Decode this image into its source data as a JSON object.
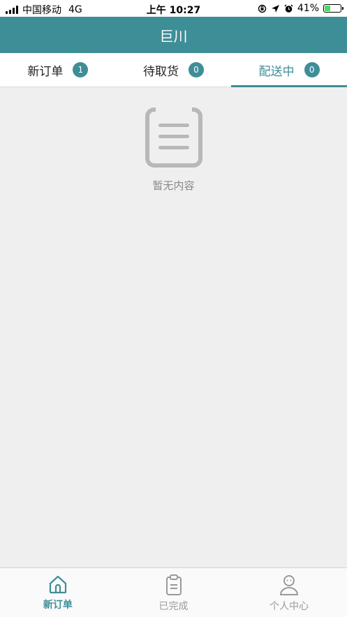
{
  "status_bar": {
    "carrier": "中国移动",
    "network": "4G",
    "time": "上午 10:27",
    "battery": "41%",
    "battery_level": 0.41
  },
  "header": {
    "title": "巨川"
  },
  "tabs": [
    {
      "label": "新订单",
      "count": "1"
    },
    {
      "label": "待取货",
      "count": "0"
    },
    {
      "label": "配送中",
      "count": "0"
    }
  ],
  "empty_state": {
    "text": "暂无内容"
  },
  "bottom_nav": [
    {
      "label": "新订单",
      "icon": "home-icon"
    },
    {
      "label": "已完成",
      "icon": "clipboard-icon"
    },
    {
      "label": "个人中心",
      "icon": "user-icon"
    }
  ],
  "colors": {
    "accent": "#3e8e98",
    "background": "#efefef"
  }
}
